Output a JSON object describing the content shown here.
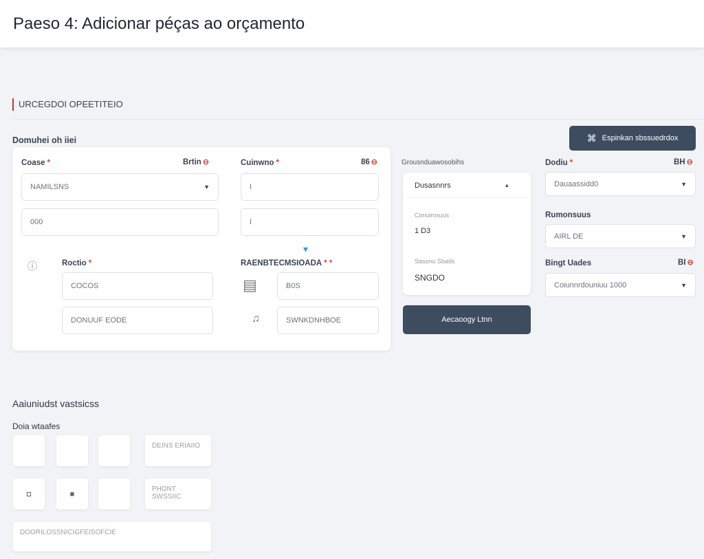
{
  "header": {
    "title": "Paeso 4: Adicionar péças ao orçamento"
  },
  "section": {
    "title": "URCEGDOI OPEETITEIO"
  },
  "group_label": "Domuhei oh iiei",
  "top_button": {
    "label": "Espinkan sbssuedrdox",
    "icon": "⌘"
  },
  "form": {
    "col1_label": "Coase",
    "col1_hint": "Brtin",
    "col2_label": "Cuinwno",
    "col2_hint": "86",
    "select1_value": "NAMILSNS",
    "input1_value": "000",
    "input2_value": "I",
    "input3_value": "I",
    "row2_label": "Roctio",
    "row2_label_right": "RAENBTECMSIOADA",
    "field_a": "COCOS",
    "field_b": "DONUUF EODE",
    "field_c": "B0S",
    "field_d": "SWNKDNHBOE",
    "info_icon": "ⓘ",
    "calendar_icon": "▤",
    "person_icon": "♫",
    "arrow_icon": "▾"
  },
  "panel": {
    "header": "Grousnduawosobihs",
    "select_value": "Dusasnnrs",
    "subtitle1": "Conuimsuus",
    "value1": "1 D3",
    "subtitle2": "Sasonu Sbads",
    "value2": "SNGDO",
    "button_label": "Aecaoogy Ltnn"
  },
  "right": {
    "label1": "Dodiu",
    "hint1": "BH",
    "select1": "Dauaassidd0",
    "label2": "Rumonsuus",
    "select2": "AIRL DE",
    "label3": "Bingt Uades",
    "hint3": "BI",
    "select3": "Coiunnrdouniuu 1000"
  },
  "bottom": {
    "title": "Aaiuniudst vastsicss",
    "subtitle": "Doia wtaafes",
    "box_text1": "DEINS ERIAIIO",
    "box_text2": "PHONT SWSSIIC",
    "box_icon1": "◘",
    "box_icon2": "■",
    "footer_text": "DOORILOSSNICIGFEISOFCIE"
  }
}
